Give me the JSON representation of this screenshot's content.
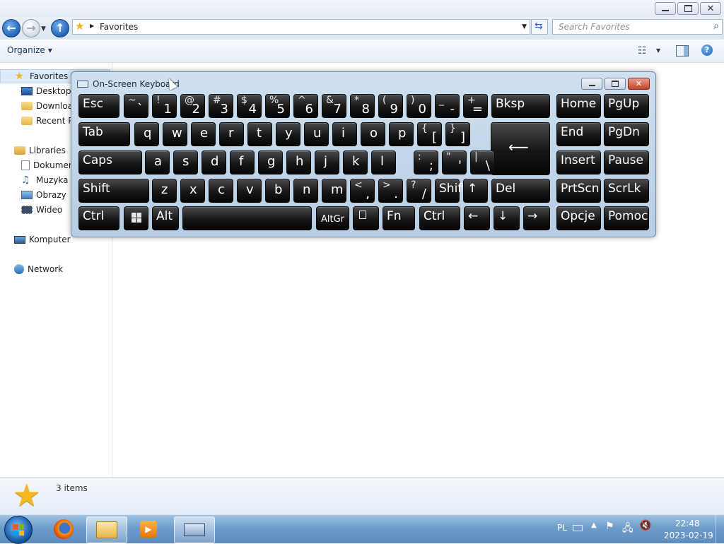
{
  "window": {
    "address_text": "Favorites",
    "search_placeholder": "Search Favorites",
    "organize_label": "Organize",
    "details_count": "3 items"
  },
  "nav": {
    "favorites": "Favorites",
    "desktop": "Desktop",
    "downloads": "Downloads",
    "recent": "Recent Places",
    "libraries": "Libraries",
    "documents": "Dokumenty",
    "music": "Muzyka",
    "pictures": "Obrazy",
    "video": "Wideo",
    "computer": "Komputer",
    "network": "Network"
  },
  "osk": {
    "title": "On-Screen Keyboard",
    "rows": [
      [
        {
          "n": "esc",
          "label": "Esc"
        },
        {
          "n": "tilde",
          "top": "~",
          "bot": "`"
        },
        {
          "n": "1",
          "top": "!",
          "bot": "1"
        },
        {
          "n": "2",
          "top": "@",
          "bot": "2"
        },
        {
          "n": "3",
          "top": "#",
          "bot": "3"
        },
        {
          "n": "4",
          "top": "$",
          "bot": "4"
        },
        {
          "n": "5",
          "top": "%",
          "bot": "5"
        },
        {
          "n": "6",
          "top": "^",
          "bot": "6"
        },
        {
          "n": "7",
          "top": "&",
          "bot": "7"
        },
        {
          "n": "8",
          "top": "*",
          "bot": "8"
        },
        {
          "n": "9",
          "top": "(",
          "bot": "9"
        },
        {
          "n": "0",
          "top": ")",
          "bot": "0"
        },
        {
          "n": "minus",
          "top": "_",
          "bot": "-"
        },
        {
          "n": "equals",
          "top": "+",
          "bot": "="
        },
        {
          "n": "bksp",
          "label": "Bksp"
        },
        {
          "n": "home",
          "label": "Home"
        },
        {
          "n": "pgup",
          "label": "PgUp"
        }
      ],
      [
        {
          "n": "tab",
          "label": "Tab"
        },
        {
          "n": "q",
          "main": "q"
        },
        {
          "n": "w",
          "main": "w"
        },
        {
          "n": "e",
          "main": "e"
        },
        {
          "n": "r",
          "main": "r"
        },
        {
          "n": "t",
          "main": "t"
        },
        {
          "n": "y",
          "main": "y"
        },
        {
          "n": "u",
          "main": "u"
        },
        {
          "n": "i",
          "main": "i"
        },
        {
          "n": "o",
          "main": "o"
        },
        {
          "n": "p",
          "main": "p"
        },
        {
          "n": "lbracket",
          "top": "{",
          "bot": "["
        },
        {
          "n": "rbracket",
          "top": "}",
          "bot": "]"
        },
        {
          "n": "enter",
          "label": "⟵"
        },
        {
          "n": "end",
          "label": "End"
        },
        {
          "n": "pgdn",
          "label": "PgDn"
        }
      ],
      [
        {
          "n": "caps",
          "label": "Caps"
        },
        {
          "n": "a",
          "main": "a"
        },
        {
          "n": "s",
          "main": "s"
        },
        {
          "n": "d",
          "main": "d"
        },
        {
          "n": "f",
          "main": "f"
        },
        {
          "n": "g",
          "main": "g"
        },
        {
          "n": "h",
          "main": "h"
        },
        {
          "n": "j",
          "main": "j"
        },
        {
          "n": "k",
          "main": "k"
        },
        {
          "n": "l",
          "main": "l"
        },
        {
          "n": "semicolon",
          "top": ":",
          "bot": ";"
        },
        {
          "n": "quote",
          "top": "\"",
          "bot": "'"
        },
        {
          "n": "backslash",
          "top": "|",
          "bot": "\\"
        },
        {
          "n": "insert",
          "label": "Insert"
        },
        {
          "n": "pause",
          "label": "Pause"
        }
      ],
      [
        {
          "n": "lshift",
          "label": "Shift"
        },
        {
          "n": "z",
          "main": "z"
        },
        {
          "n": "x",
          "main": "x"
        },
        {
          "n": "c",
          "main": "c"
        },
        {
          "n": "v",
          "main": "v"
        },
        {
          "n": "b",
          "main": "b"
        },
        {
          "n": "n",
          "main": "n"
        },
        {
          "n": "m",
          "main": "m"
        },
        {
          "n": "comma",
          "top": "<",
          "bot": ","
        },
        {
          "n": "period",
          "top": ">",
          "bot": "."
        },
        {
          "n": "slash",
          "top": "?",
          "bot": "/"
        },
        {
          "n": "rshift",
          "label": "Shift"
        },
        {
          "n": "up",
          "label": "↑"
        },
        {
          "n": "del",
          "label": "Del"
        },
        {
          "n": "prtscn",
          "label": "PrtScn"
        },
        {
          "n": "scrlk",
          "label": "ScrLk"
        }
      ],
      [
        {
          "n": "lctrl",
          "label": "Ctrl"
        },
        {
          "n": "win",
          "icon": "windows-logo"
        },
        {
          "n": "alt",
          "label": "Alt"
        },
        {
          "n": "space",
          "label": ""
        },
        {
          "n": "altgr",
          "label": "AltGr",
          "small": true
        },
        {
          "n": "menu",
          "icon": "menu-key"
        },
        {
          "n": "fn",
          "label": "Fn"
        },
        {
          "n": "rctrl",
          "label": "Ctrl"
        },
        {
          "n": "left",
          "label": "←"
        },
        {
          "n": "down",
          "label": "↓"
        },
        {
          "n": "right",
          "label": "→"
        },
        {
          "n": "opcje",
          "label": "Opcje"
        },
        {
          "n": "pomoc",
          "label": "Pomoc"
        }
      ]
    ]
  },
  "taskbar": {
    "lang": "PL",
    "time": "22:48",
    "date": "2023-02-19"
  }
}
